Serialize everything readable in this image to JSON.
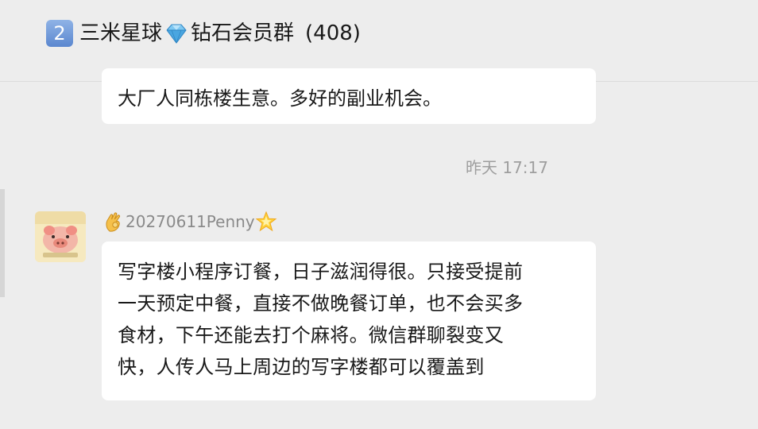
{
  "chat": {
    "title_badge": "2",
    "title_name_part1": "三米星球",
    "title_name_part2": "钻石会员群",
    "title_count": "(408)"
  },
  "messages": {
    "top_bubble_text": "大厂人同栋楼生意。多好的副业机会。",
    "timestamp": "昨天 17:17",
    "sender_name": "20270611Penny",
    "main_lines": [
      "写字楼小程序订餐，日子滋润得很。只接受提前",
      "一天预定中餐，直接不做晚餐订单，也不会买多",
      "食材，下午还能去打个麻将。微信群聊裂变又",
      "快，人传人马上周边的写字楼都可以覆盖到"
    ]
  },
  "icons": {
    "title_badge": "keycap-digit-two-icon",
    "title_emoji": "gem-stone-icon",
    "sender_prefix": "ok-hand-icon",
    "sender_suffix": "glowing-star-icon",
    "avatar": "cartoon-avatar"
  },
  "colors": {
    "background": "#ededed",
    "bubble": "#ffffff",
    "text": "#191919",
    "meta_text": "#9e9e9e"
  }
}
